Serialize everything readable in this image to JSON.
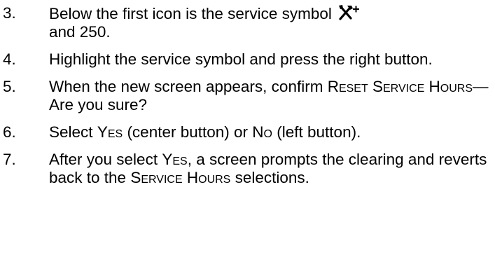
{
  "steps": [
    {
      "number": "3.",
      "pre": "Below the first icon is the service symbol",
      "icon": "service-wrench-plus-icon",
      "post": "and 250."
    },
    {
      "number": "4.",
      "text": "Highlight the service symbol and press the right button."
    },
    {
      "number": "5.",
      "pre": "When the new screen appears, confirm",
      "sc": "Reset Service Hours",
      "post": "—Are you sure?"
    },
    {
      "number": "6.",
      "pre": "Select",
      "sc1": "Yes",
      "mid": "(center button) or",
      "sc2": "No",
      "post": "(left button)."
    },
    {
      "number": "7.",
      "pre": "After you select",
      "sc1": "Yes",
      "mid": ", a screen prompts the clearing and reverts back to the",
      "sc2": "Service Hours",
      "post": "selections."
    }
  ]
}
